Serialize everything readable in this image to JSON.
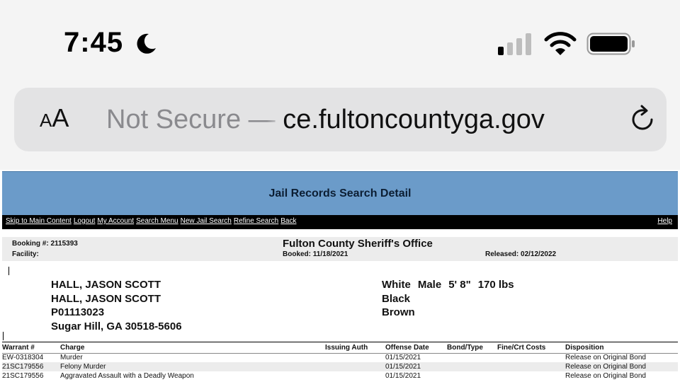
{
  "status_bar": {
    "time": "7:45",
    "icons": [
      "moon-icon",
      "cellular-signal-icon",
      "wifi-icon",
      "battery-icon"
    ]
  },
  "browser": {
    "text_size_button": "AA",
    "security_label": "Not Secure —",
    "url": "ce.fultoncountyga.gov",
    "reload_icon": "reload-icon"
  },
  "page": {
    "title": "Jail Records Search Detail",
    "nav_links": [
      "Skip to Main Content",
      "Logout",
      "My Account",
      "Search Menu",
      "New Jail Search",
      "Refine Search",
      "Back"
    ],
    "help": "Help",
    "booking": "Booking #: 2115393",
    "facility": "Facility:",
    "office": "Fulton County Sheriff's Office",
    "booked": "Booked: 11/18/2021",
    "released": "Released: 02/12/2022",
    "person": {
      "name": "HALL, JASON SCOTT",
      "alias": "HALL, JASON SCOTT",
      "id": "P01113023",
      "address": "Sugar Hill, GA 30518-5606"
    },
    "physical": {
      "race": "White",
      "sex": "Male",
      "height": "5' 8\"",
      "weight": "170 lbs",
      "hair": "Black",
      "eyes": "Brown"
    },
    "table": {
      "headers": [
        "Warrant #",
        "Charge",
        "Issuing Auth",
        "Offense Date",
        "Bond/Type",
        "Fine/Crt Costs",
        "Disposition"
      ],
      "rows": [
        [
          "EW-0318304",
          "Murder",
          "",
          "01/15/2021",
          "",
          "",
          "Release on Original Bond"
        ],
        [
          "21SC179556",
          "Felony Murder",
          "",
          "01/15/2021",
          "",
          "",
          "Release on Original Bond"
        ],
        [
          "21SC179556",
          "Aggravated Assault with a Deadly Weapon",
          "",
          "01/15/2021",
          "",
          "",
          "Release on Original Bond"
        ]
      ]
    }
  },
  "colors": {
    "header_bg": "#6b9bc9",
    "nav_bg": "#000000",
    "address_bar_bg": "#e3e3e4",
    "insecure_text": "#8a8a8e"
  }
}
